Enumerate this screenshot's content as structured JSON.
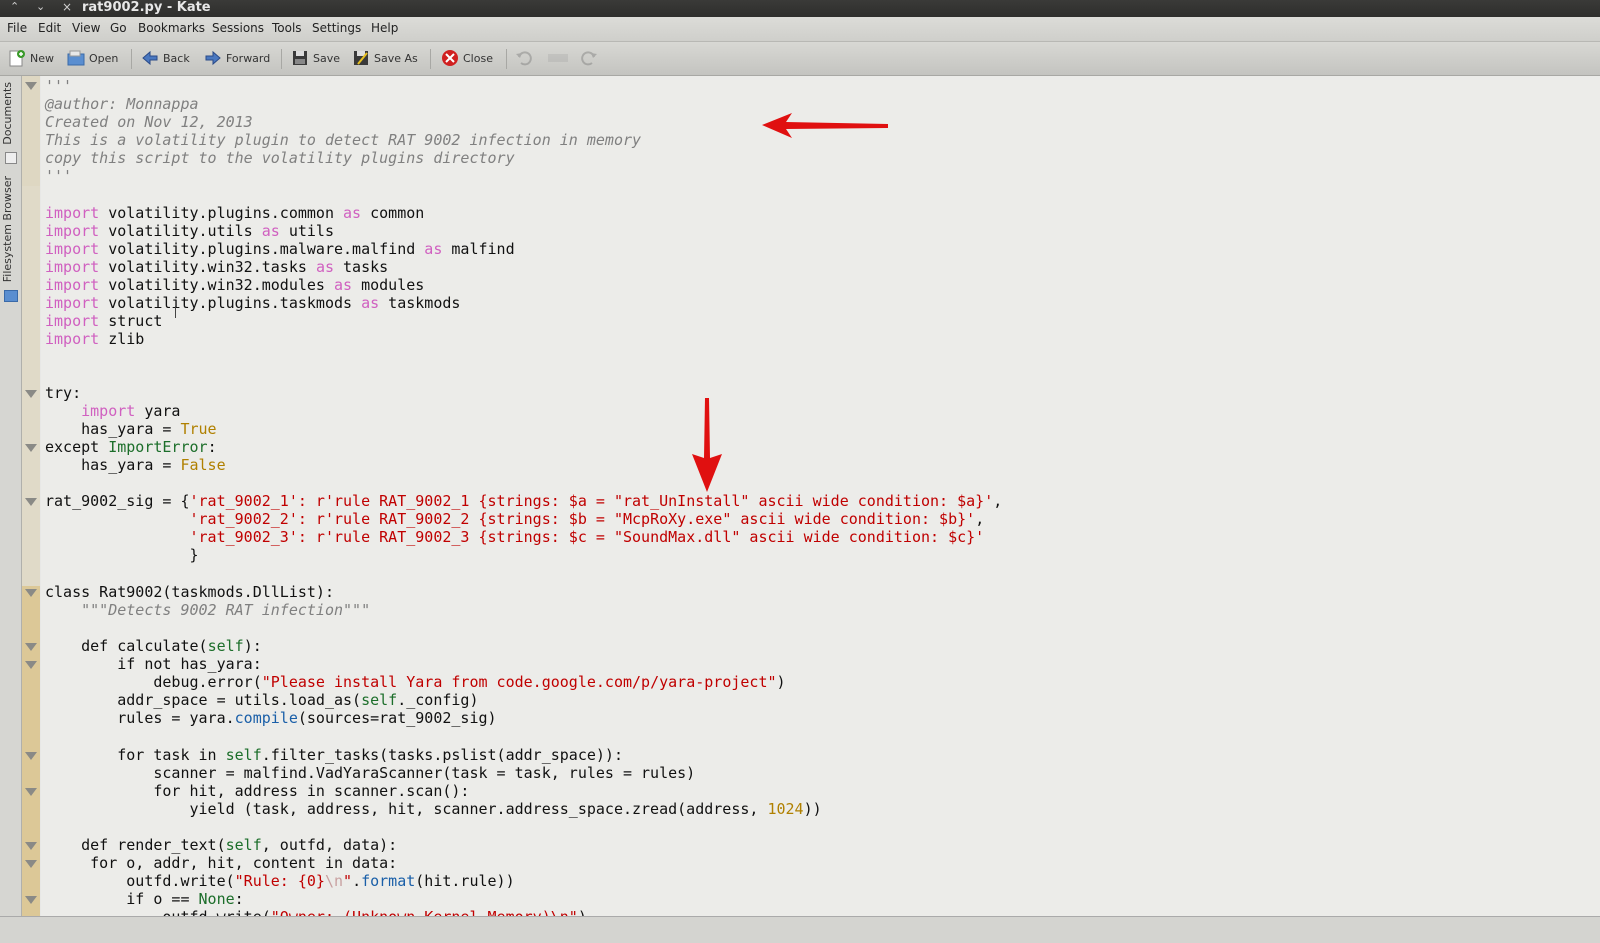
{
  "window": {
    "title": "rat9002.py - Kate",
    "close_glyph": "×",
    "up_glyph": "⌃",
    "down_glyph": "⌄"
  },
  "menu": [
    "File",
    "Edit",
    "View",
    "Go",
    "Bookmarks",
    "Sessions",
    "Tools",
    "Settings",
    "Help"
  ],
  "toolbar": {
    "new": "New",
    "open": "Open",
    "back": "Back",
    "forward": "Forward",
    "save": "Save",
    "save_as": "Save As",
    "close": "Close"
  },
  "side_tabs": {
    "documents": "Documents",
    "filesystem": "Filesystem Browser"
  },
  "colors": {
    "comment": "#808080",
    "keyword": "#d060c0",
    "string": "#c00000",
    "builtin": "#1c6e2a",
    "number": "#b08000",
    "annotation_arrow": "#e01010"
  },
  "code": {
    "l1": "'''",
    "l2": "@author: Monnappa",
    "l3": "Created on Nov 12, 2013",
    "l4": "This is a volatility plugin to detect RAT 9002 infection in memory",
    "l5": "copy this script to the volatility plugins directory",
    "l6": "'''",
    "imp": "import",
    "as": "as",
    "i1": " volatility.plugins.common ",
    "i1b": " common",
    "i2": " volatility.utils ",
    "i2b": " utils",
    "i3": " volatility.plugins.malware.malfind ",
    "i3b": " malfind",
    "i4": " volatility.win32.tasks ",
    "i4b": " tasks",
    "i5": " volatility.win32.modules ",
    "i5b": " modules",
    "i6": " volatility.plugins.taskmods ",
    "i6b": " taskmods",
    "i7": " struct",
    "i8": " zlib",
    "t1": "try:",
    "t2": " yara",
    "t3a": "    has_yara = ",
    "t3b": "True",
    "t4a": "except ",
    "t4b": "ImportError",
    "t4c": ":",
    "t5a": "    has_yara = ",
    "t5b": "False",
    "s1a": "rat_9002_sig = {",
    "s1b": "'rat_9002_1': r'rule RAT_9002_1 {strings: $a = \"rat_UnInstall\" ascii wide condition: $a}'",
    "s1c": ",",
    "s2a": "                ",
    "s2b": "'rat_9002_2': r'rule RAT_9002_2 {strings: $b = \"McpRoXy.exe\" ascii wide condition: $b}'",
    "s2c": ",",
    "s3a": "                ",
    "s3b": "'rat_9002_3': r'rule RAT_9002_3 {strings: $c = \"SoundMax.dll\" ascii wide condition: $c}'",
    "s4": "                }",
    "c1": "class Rat9002(taskmods.DllList):",
    "c2": "    \"\"\"Detects 9002 RAT infection\"\"\"",
    "d1a": "    def calculate(",
    "d1b": "self",
    "d1c": "):",
    "d2": "        if not has_yara:",
    "d3a": "            debug.error(",
    "d3b": "\"Please install Yara from code.google.com/p/yara-project\"",
    "d3c": ")",
    "d4a": "        addr_space = utils.load_as(",
    "d4b": "self",
    "d4c": "._config)",
    "d5a": "        rules = yara.",
    "d5b": "compile",
    "d5c": "(sources=rat_9002_sig)",
    "d6a": "        for task in ",
    "d6b": "self",
    "d6c": ".filter_tasks(tasks.pslist(addr_space)):",
    "d7": "            scanner = malfind.VadYaraScanner(task = task, rules = rules)",
    "d8": "            for hit, address in scanner.scan():",
    "d9a": "                yield (task, address, hit, scanner.address_space.zread(address, ",
    "d9b": "1024",
    "d9c": "))",
    "r1a": "    def render_text(",
    "r1b": "self",
    "r1c": ", outfd, data):",
    "r2": "     for o, addr, hit, content in data:",
    "r3a": "         outfd.write(",
    "r3b": "\"Rule: {0}",
    "r3c": "\\n",
    "r3d": "\"",
    "r3e": ".",
    "r3f": "format",
    "r3g": "(hit.rule))",
    "r4a": "         if o == ",
    "r4b": "None",
    "r4c": ":",
    "r5a": "             outfd.write(",
    "r5b": "\"Owner: (Unknown Kernel Memory)\\n\"",
    "r5c": ")"
  }
}
